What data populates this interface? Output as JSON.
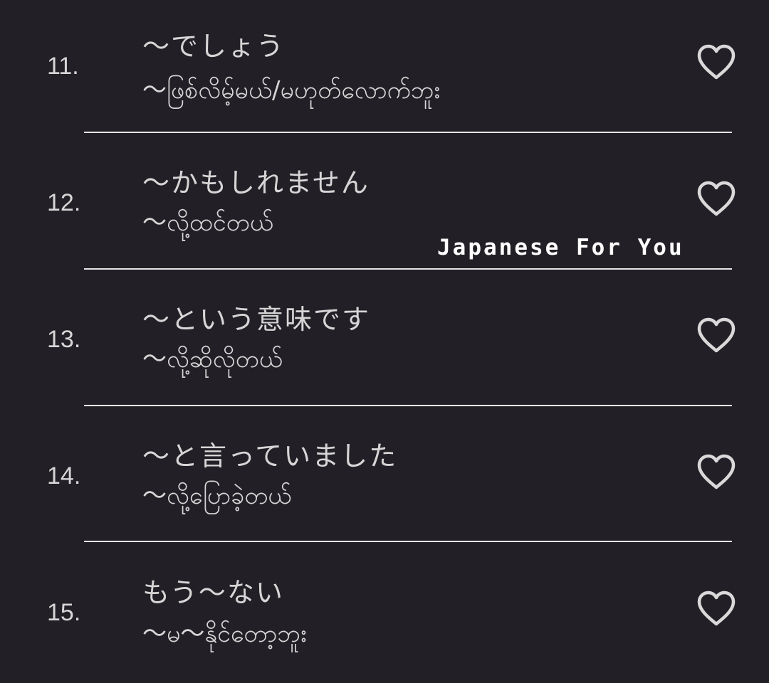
{
  "items": [
    {
      "number": "11.",
      "japanese": "〜でしょう",
      "burmese": "〜ဖြစ်လိမ့်မယ်/မဟုတ်လောက်ဘူး",
      "favorite_icon": "heart-outline-icon"
    },
    {
      "number": "12.",
      "japanese": "〜かもしれません",
      "burmese": "〜လို့ထင်တယ်",
      "favorite_icon": "heart-outline-icon"
    },
    {
      "number": "13.",
      "japanese": "〜という意味です",
      "burmese": "〜လို့ဆိုလိုတယ်",
      "favorite_icon": "heart-outline-icon"
    },
    {
      "number": "14.",
      "japanese": "〜と言っていました",
      "burmese": "〜လို့ပြောခဲ့တယ်",
      "favorite_icon": "heart-outline-icon"
    },
    {
      "number": "15.",
      "japanese": "もう〜ない",
      "burmese": "〜မ〜နိုင်တော့ဘူး",
      "favorite_icon": "heart-outline-icon"
    }
  ],
  "watermark": "Japanese For You",
  "colors": {
    "background": "#221f26",
    "text": "#d6d6d6",
    "divider": "#e6e6e6",
    "heart_stroke": "#d9d9d9"
  }
}
